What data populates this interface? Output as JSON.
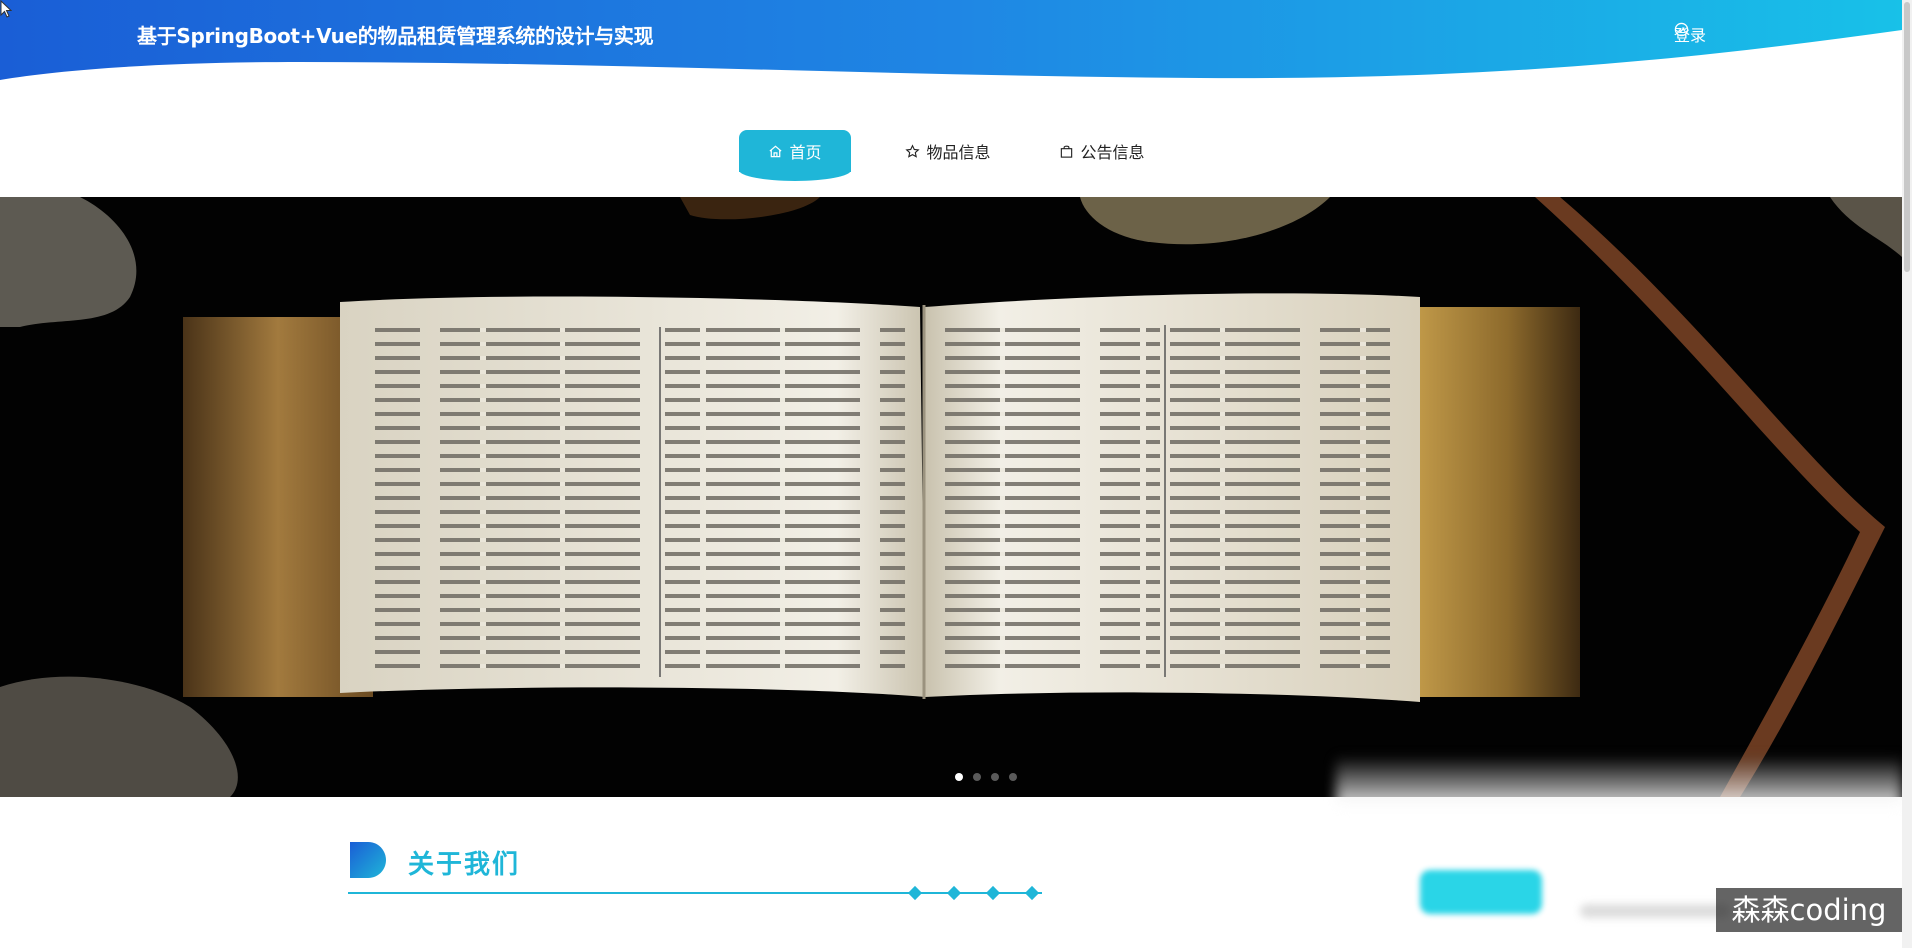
{
  "header": {
    "title": "基于SpringBoot+Vue的物品租赁管理系统的设计与实现",
    "login_label": "登录",
    "login_icon": "check-circle-icon"
  },
  "nav": {
    "items": [
      {
        "label": "首页",
        "icon": "home-icon",
        "active": true
      },
      {
        "label": "物品信息",
        "icon": "star-icon",
        "active": false
      },
      {
        "label": "公告信息",
        "icon": "bag-icon",
        "active": false
      }
    ]
  },
  "banner": {
    "image": "open-old-book-photo",
    "slide_count": 4,
    "active_slide": 1
  },
  "about": {
    "title": "关于我们"
  },
  "watermark": "森森coding",
  "colors": {
    "header_blue": "#1e6fd9",
    "accent_teal": "#1fb6d8"
  }
}
